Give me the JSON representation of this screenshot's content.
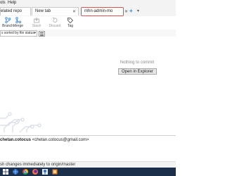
{
  "menu": {
    "items": [
      "ols",
      "Help"
    ]
  },
  "tabs": [
    {
      "label": "elated repo",
      "close": "✕"
    },
    {
      "label": "New tab",
      "close": "✕"
    },
    {
      "label": "mhn-admin-mo",
      "close": "✕",
      "active": true
    }
  ],
  "tab_add": "+",
  "tab_dropdown": "▾",
  "toolbar": {
    "branch": "Branch",
    "merge": "Merge",
    "stash": "Stash",
    "discard": "Discard",
    "tag": "Tag"
  },
  "filter": {
    "value": "s sorted by file status",
    "chevron": "▾"
  },
  "main": {
    "nothing_text": "Nothing to commit",
    "open_explorer": "Open in Explorer"
  },
  "author": {
    "username": "chetan.cotocus",
    "email": "<chetan.cotocus@gmail.com>"
  },
  "push": {
    "label": "sh changes immediately to origin/master",
    "checked": false
  },
  "colors": {
    "tab_highlight": "#e05050",
    "accent_blue": "#3a7fd6",
    "taskbar": "#1b2f4a"
  },
  "taskbar": {
    "icons": [
      "windows-icon",
      "globe-icon",
      "chrome-icon",
      "firefox-icon",
      "sourcetree-icon",
      "app-icon"
    ]
  }
}
